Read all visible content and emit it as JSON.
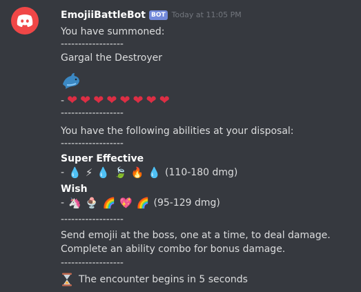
{
  "message": {
    "username": "EmojiiBattleBot",
    "bot_tag": "BOT",
    "timestamp": "Today at 11:05 PM",
    "summon_text": "You have summoned:",
    "separator": "------------------",
    "monster_name": "Gargal the Destroyer",
    "monster_icon": "dolphin-emoji",
    "hp_prefix": "-",
    "hearts": 8,
    "heart_symbol": "❤",
    "abilities_intro": "You have the following abilities at your disposal:",
    "abilities": [
      {
        "name": "Super Effective",
        "prefix": "-",
        "emojis": [
          "💧",
          "⚡",
          "💧",
          "🍃",
          "🔥",
          "💧"
        ],
        "damage": "(110-180 dmg)"
      },
      {
        "name": "Wish",
        "prefix": "-",
        "emojis": [
          "🦄",
          "🍨",
          "🌈",
          "💖",
          "🌈"
        ],
        "damage": "(95-129 dmg)"
      }
    ],
    "instructions_1": "Send emojii at the boss, one at a time, to deal damage.",
    "instructions_2": "Complete an ability combo for bonus damage.",
    "encounter_icon": "hourglass-emoji",
    "encounter_text": "The encounter begins in 5 seconds"
  }
}
